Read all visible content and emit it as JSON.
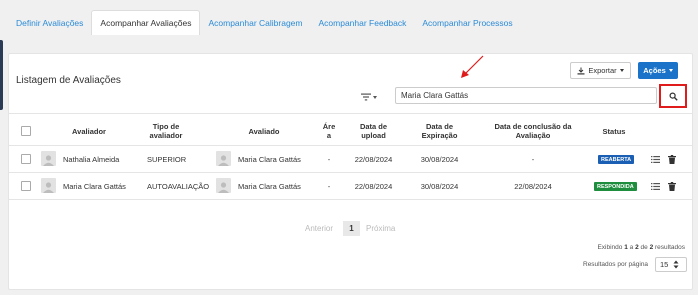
{
  "tabs": [
    {
      "label": "Definir Avaliações"
    },
    {
      "label": "Acompanhar Avaliações"
    },
    {
      "label": "Acompanhar Calibragem"
    },
    {
      "label": "Acompanhar Feedback"
    },
    {
      "label": "Acompanhar Processos"
    }
  ],
  "active_tab": "Acompanhar Avaliações",
  "panel": {
    "title": "Listagem de Avaliações",
    "export_label": "Exportar",
    "actions_label": "Ações",
    "search_value": "Maria Clara Gattás"
  },
  "table": {
    "headers": {
      "avaliador": "Avaliador",
      "tipo": "Tipo de avaliador",
      "avaliado": "Avaliado",
      "area": "Áre a",
      "upload": "Data de upload",
      "expiracao": "Data de Expiração",
      "conclusao": "Data de conclusão da Avaliação",
      "status": "Status"
    },
    "rows": [
      {
        "avaliador": "Nathalia Almeida",
        "tipo": "SUPERIOR",
        "avaliado": "Maria Clara Gattás",
        "area": "-",
        "upload": "22/08/2024",
        "expiracao": "30/08/2024",
        "conclusao": "-",
        "status": "REABERTA",
        "status_color": "#1a5fb4"
      },
      {
        "avaliador": "Maria Clara Gattás",
        "tipo": "AUTOAVALIAÇÃO",
        "avaliado": "Maria Clara Gattás",
        "area": "-",
        "upload": "22/08/2024",
        "expiracao": "30/08/2024",
        "conclusao": "22/08/2024",
        "status": "RESPONDIDA",
        "status_color": "#1e8e3e"
      }
    ]
  },
  "pagination": {
    "prev": "Anterior",
    "current": "1",
    "next": "Próxima"
  },
  "summary": {
    "prefix": "Exibindo",
    "from": "1",
    "mid": "a",
    "to": "2",
    "of": "de",
    "total": "2",
    "suffix": "resultados",
    "per_page_label": "Resultados por página",
    "per_page_value": "15"
  },
  "colors": {
    "primary": "#1a73c9",
    "link": "#2a8bd8",
    "highlight": "#e01b1b"
  },
  "icons": [
    "filter-icon",
    "search-icon",
    "download-icon",
    "list-icon",
    "trash-icon",
    "user-icon",
    "arrow-annotation"
  ]
}
